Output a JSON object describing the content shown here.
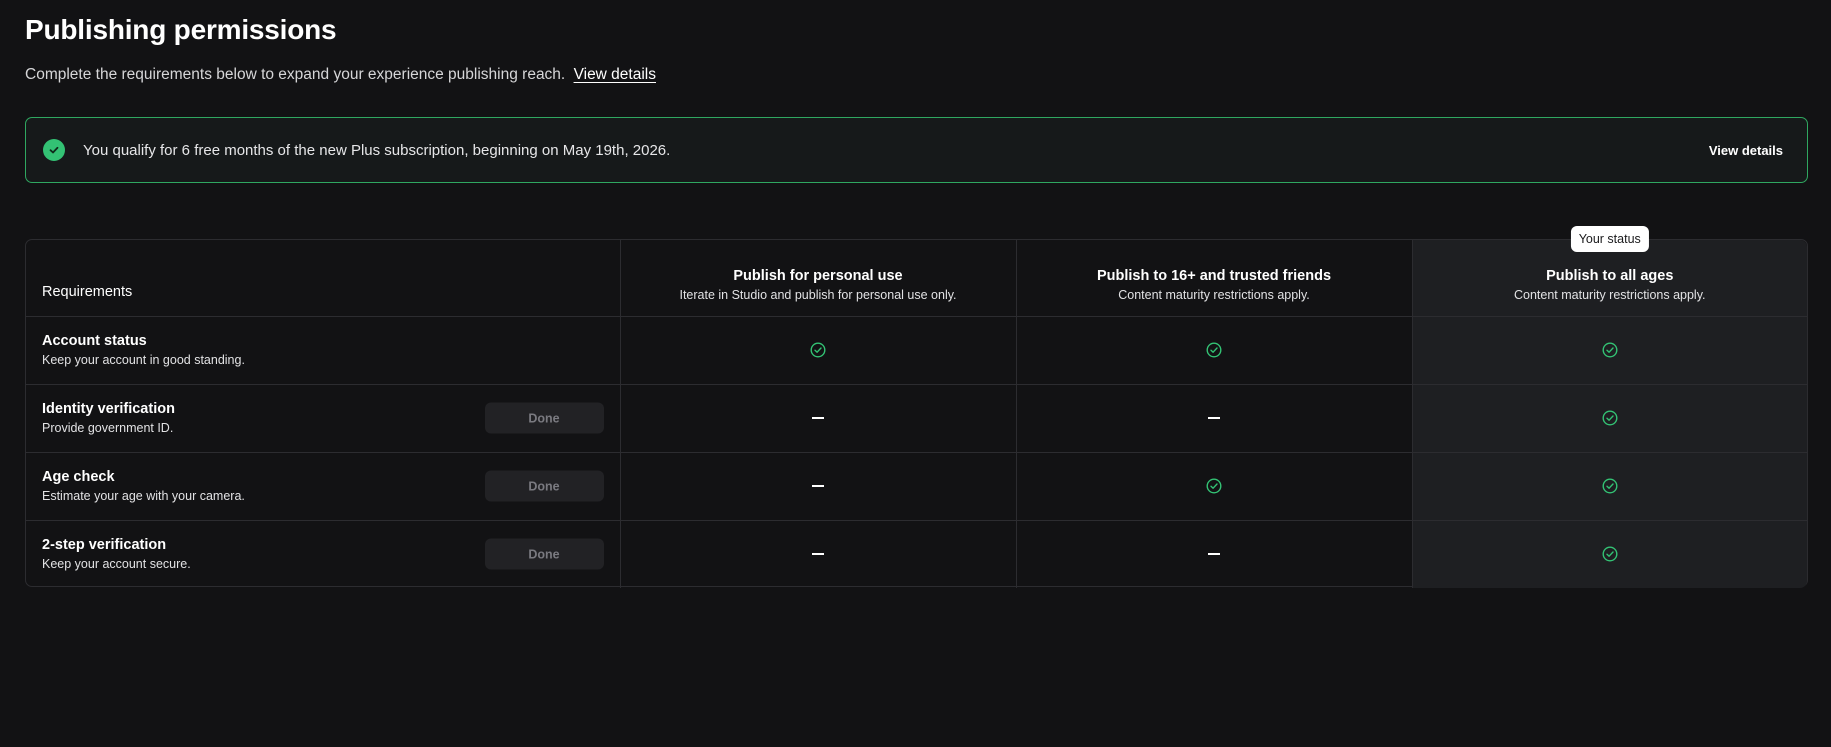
{
  "header": {
    "title": "Publishing permissions",
    "subtitle": "Complete the requirements below to expand your experience publishing reach.",
    "subtitle_link": "View details"
  },
  "banner": {
    "message": "You qualify for 6 free months of the new Plus subscription, beginning on May 19th, 2026.",
    "action_label": "View details",
    "accent_color": "#33c274"
  },
  "table": {
    "requirements_header": "Requirements",
    "columns": [
      {
        "title": "Publish for personal use",
        "description": "Iterate in Studio and publish for personal use only."
      },
      {
        "title": "Publish to 16+ and trusted friends",
        "description": "Content maturity restrictions apply."
      },
      {
        "title": "Publish to all ages",
        "description": "Content maturity restrictions apply.",
        "badge": "Your status"
      }
    ],
    "rows": [
      {
        "title": "Account status",
        "description": "Keep your account in good standing.",
        "action": null,
        "marks": [
          "check-icon",
          "check-icon",
          "check-icon"
        ]
      },
      {
        "title": "Identity verification",
        "description": "Provide government ID.",
        "action": "Done",
        "marks": [
          "dash-icon",
          "dash-icon",
          "check-icon"
        ]
      },
      {
        "title": "Age check",
        "description": "Estimate your age with your camera.",
        "action": "Done",
        "marks": [
          "dash-icon",
          "check-icon",
          "check-icon"
        ]
      },
      {
        "title": "2-step verification",
        "description": "Keep your account secure.",
        "action": "Done",
        "marks": [
          "dash-icon",
          "dash-icon",
          "check-icon"
        ]
      }
    ]
  }
}
